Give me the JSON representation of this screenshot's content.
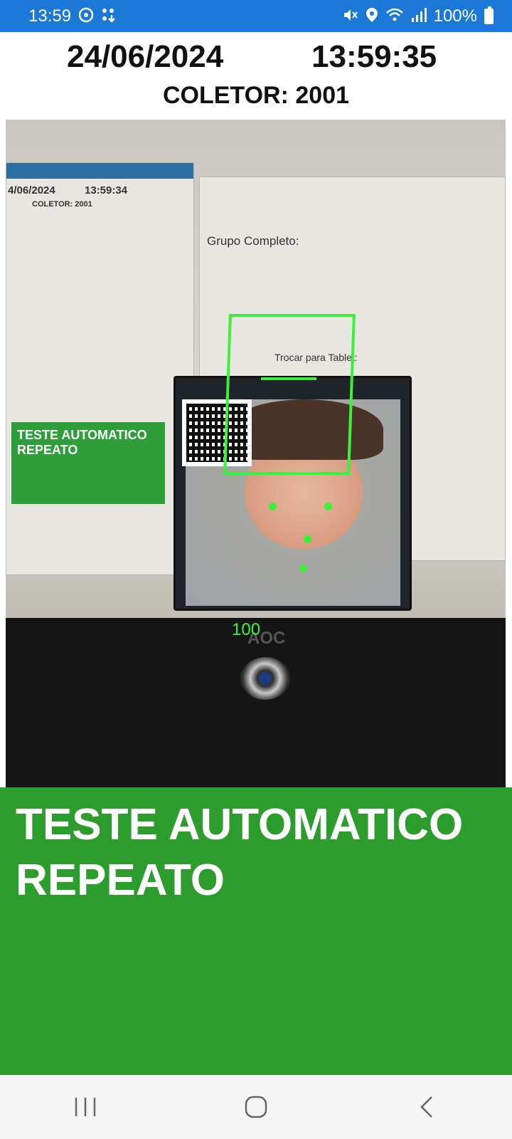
{
  "status_bar": {
    "time": "13:59",
    "left_icons": [
      "face-app-icon",
      "dots-download-icon"
    ],
    "right_icons": [
      "mute-icon",
      "location-icon",
      "wifi-icon",
      "signal-icon"
    ],
    "battery": "100%"
  },
  "header": {
    "date": "24/06/2024",
    "time": "13:59:35",
    "collector_label": "COLETOR:",
    "collector_value": "2001"
  },
  "camera_preview": {
    "background_screen": {
      "date": "4/06/2024",
      "time": "13:59:34",
      "collector": "COLETOR: 2001",
      "group_title": "Grupo Completo:",
      "tablet_label": "Trocar para Tablet:",
      "green_text": "TESTE AUTOMATICO REPEATO",
      "monitor_brand": "AOC"
    },
    "face_detection": {
      "score": "100",
      "color": "#3df03a"
    }
  },
  "result": {
    "title_line1": "TESTE AUTOMATICO",
    "title_line2": "REPEATO",
    "color": "#2c9c2d"
  },
  "nav_bar": {
    "buttons": [
      "recent-apps",
      "home",
      "back"
    ]
  }
}
